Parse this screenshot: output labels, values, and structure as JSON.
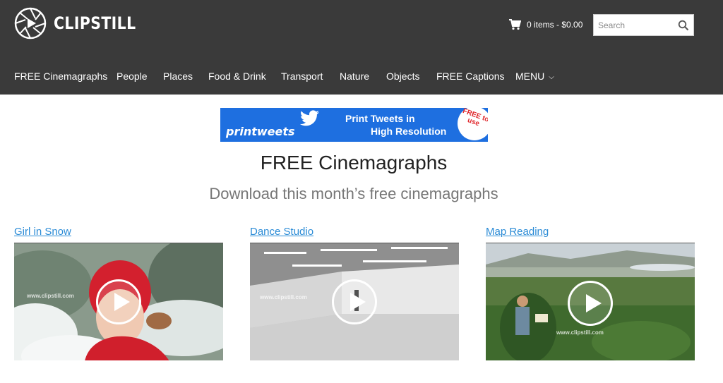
{
  "brand": {
    "name": "CLIPSTILL"
  },
  "header": {
    "cart_text": "0 items - $0.00",
    "search_placeholder": "Search"
  },
  "nav": {
    "items": [
      {
        "label": "FREE Cinemagraphs"
      },
      {
        "label": "People"
      },
      {
        "label": "Places"
      },
      {
        "label": "Food & Drink"
      },
      {
        "label": "Transport"
      },
      {
        "label": "Nature"
      },
      {
        "label": "Objects"
      },
      {
        "label": "FREE Captions"
      },
      {
        "label": "MENU"
      }
    ]
  },
  "banner": {
    "brand": "printweets",
    "line1": "Print Tweets in",
    "line2": "High Resolution",
    "badge": "FREE to use"
  },
  "page": {
    "title": "FREE Cinemagraphs",
    "subtitle": "Download this month’s free cinemagraphs"
  },
  "cards": [
    {
      "title": "Girl in Snow",
      "watermark": "www.clipstill.com"
    },
    {
      "title": "Dance Studio",
      "watermark": "www.clipstill.com"
    },
    {
      "title": "Map Reading",
      "watermark": "www.clipstill.com"
    }
  ],
  "colors": {
    "header_bg": "#3a3a3a",
    "banner_bg": "#1e6fe0",
    "link": "#2a8bd6"
  }
}
